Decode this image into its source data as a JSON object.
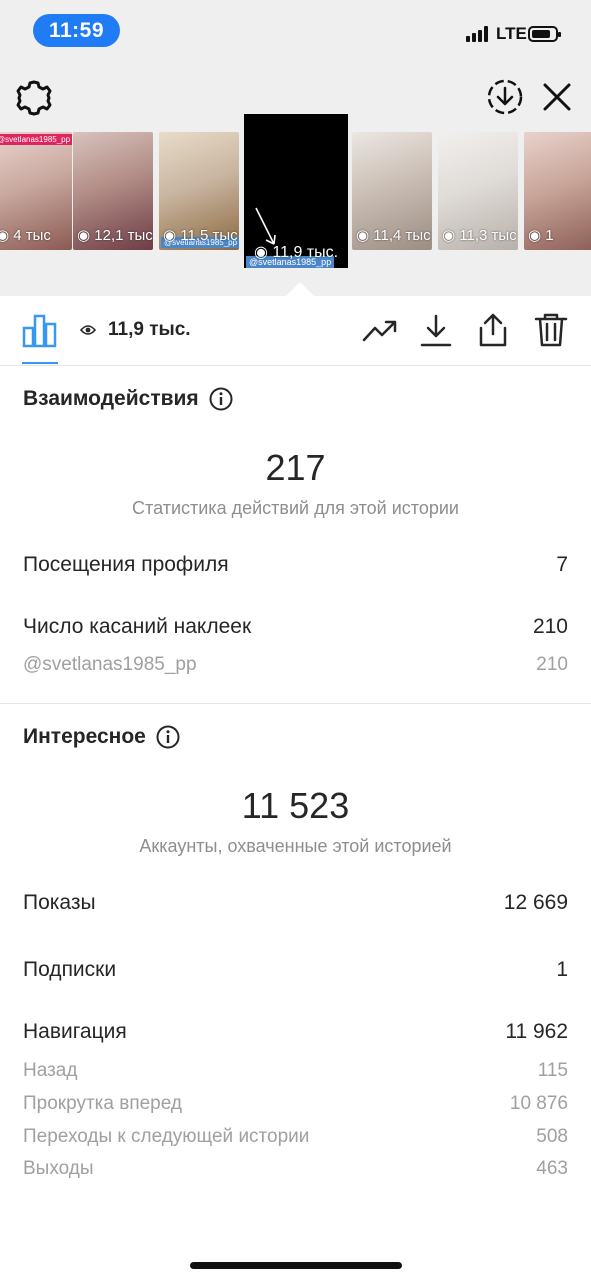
{
  "status_bar": {
    "time": "11:59",
    "network": "LTE"
  },
  "stories": [
    {
      "views": "4 тыс",
      "label": "@svetlanas1985_pp",
      "colors": [
        "#c9a9a0",
        "#8b5a52",
        "#e9d5cf"
      ]
    },
    {
      "views": "12,1 тыс",
      "label": "",
      "colors": [
        "#b28d86",
        "#6e3d46",
        "#d8c3bd"
      ]
    },
    {
      "views": "11,5 тыс",
      "label": "@svetlanas1985_pp",
      "colors": [
        "#c9b5a0",
        "#8c6a42",
        "#e8dcc9"
      ]
    },
    {
      "views": "11,9 тыс.",
      "label": "@svetlanas1985_pp",
      "colors": [
        "#000000",
        "#000000",
        "#000000"
      ],
      "selected": true
    },
    {
      "views": "11,4 тыс",
      "label": "",
      "colors": [
        "#cbbfb5",
        "#9c8d82",
        "#ece7e2"
      ]
    },
    {
      "views": "11,3 тыс",
      "label": "",
      "colors": [
        "#e0dcd8",
        "#b8b0aa",
        "#f2f0ee"
      ]
    },
    {
      "views": "1",
      "label": "",
      "colors": [
        "#c9a59a",
        "#8a5d54",
        "#e8d3cc"
      ]
    }
  ],
  "actions": {
    "views": "11,9 тыс."
  },
  "interactions": {
    "title": "Взаимодействия",
    "total": "217",
    "subtitle": "Статистика действий для этой истории",
    "rows": [
      {
        "label": "Посещения профиля",
        "value": "7"
      },
      {
        "label": "Число касаний наклеек",
        "value": "210"
      }
    ],
    "sub_rows": [
      {
        "label": "@svetlanas1985_pp",
        "value": "210"
      }
    ]
  },
  "discovery": {
    "title": "Интересное",
    "total": "11 523",
    "subtitle": "Аккаунты, охваченные этой историей",
    "rows": [
      {
        "label": "Показы",
        "value": "12 669"
      },
      {
        "label": "Подписки",
        "value": "1"
      },
      {
        "label": "Навигация",
        "value": "11 962"
      }
    ],
    "nav_rows": [
      {
        "label": "Назад",
        "value": "115"
      },
      {
        "label": "Прокрутка вперед",
        "value": "10 876"
      },
      {
        "label": "Переходы к следующей истории",
        "value": "508"
      },
      {
        "label": "Выходы",
        "value": "463"
      }
    ]
  }
}
